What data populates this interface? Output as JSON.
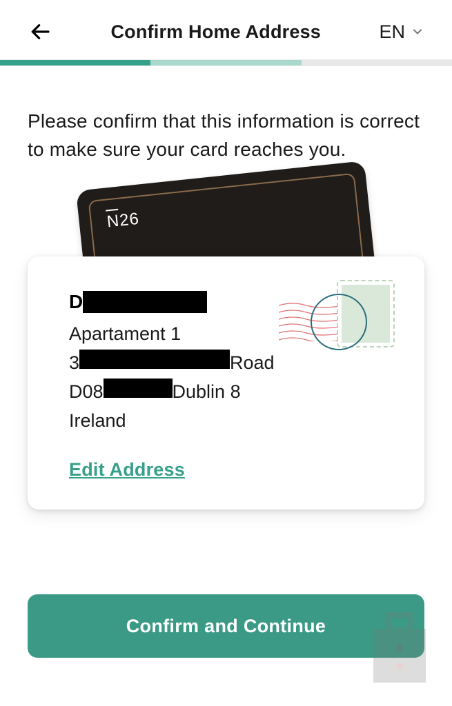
{
  "header": {
    "title": "Confirm Home Address",
    "language": "EN"
  },
  "instruction": "Please confirm that this information is correct to make sure your card reaches you.",
  "card_brand": "N26",
  "address": {
    "name_first_letter": "D",
    "line_apartment": "Apartament 1",
    "street_prefix": "3",
    "street_suffix": "Road",
    "postal_prefix": "D08",
    "city_suffix": "Dublin 8",
    "country": "Ireland"
  },
  "edit_label": "Edit Address",
  "confirm_label": "Confirm and Continue"
}
